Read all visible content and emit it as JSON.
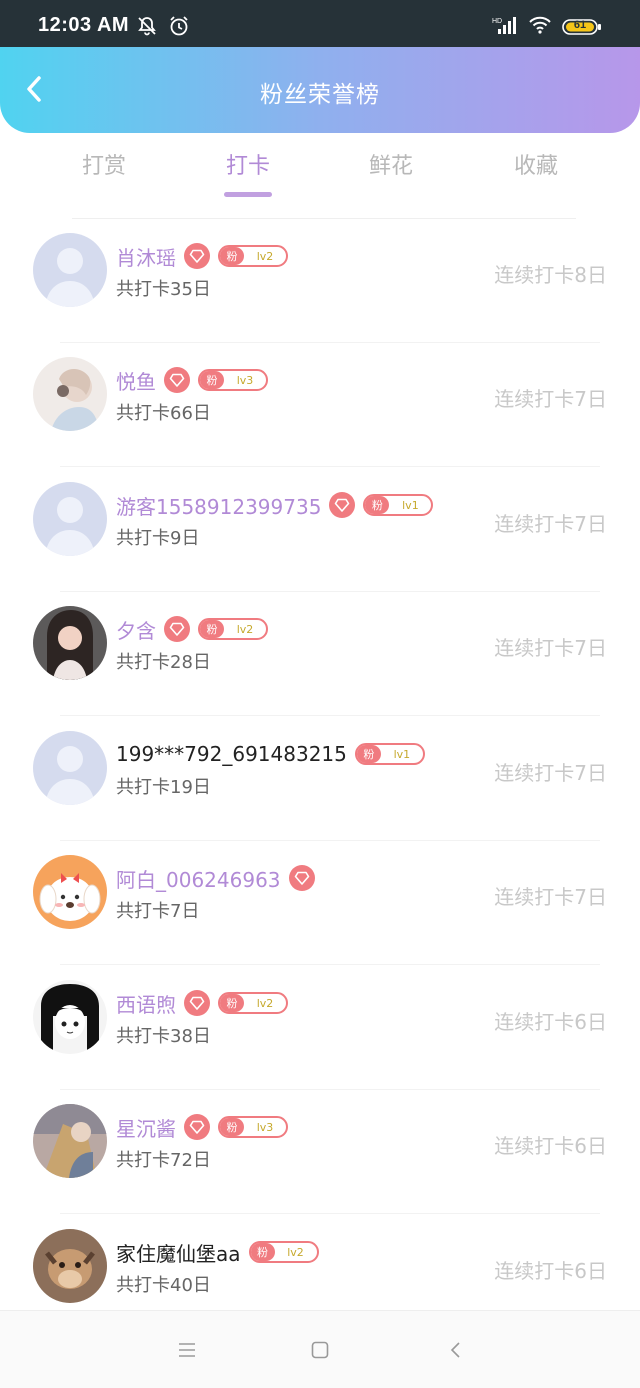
{
  "status_bar": {
    "time": "12:03 AM",
    "battery": "61"
  },
  "header": {
    "title": "粉丝荣誉榜"
  },
  "tabs": [
    {
      "label": "打赏"
    },
    {
      "label": "打卡",
      "active": true
    },
    {
      "label": "鲜花"
    },
    {
      "label": "收藏"
    }
  ],
  "rows": [
    {
      "name": "肖沐瑶",
      "name_style": "purple",
      "heart": true,
      "level": "lv2",
      "total": "共打卡35日",
      "streak": "连续打卡8日",
      "avatar": "default-avatar"
    },
    {
      "name": "悦鱼",
      "name_style": "purple",
      "heart": true,
      "level": "lv3",
      "total": "共打卡66日",
      "streak": "连续打卡7日",
      "avatar": "photo-avatar"
    },
    {
      "name": "游客1558912399735",
      "name_style": "purple",
      "heart": true,
      "level": "lv1",
      "total": "共打卡9日",
      "streak": "连续打卡7日",
      "avatar": "default-avatar"
    },
    {
      "name": "夕含",
      "name_style": "purple",
      "heart": true,
      "level": "lv2",
      "total": "共打卡28日",
      "streak": "连续打卡7日",
      "avatar": "photo-avatar"
    },
    {
      "name": "199***792_691483215",
      "name_style": "plain",
      "heart": false,
      "level": "lv1",
      "total": "共打卡19日",
      "streak": "连续打卡7日",
      "avatar": "default-avatar"
    },
    {
      "name": "阿白_006246963",
      "name_style": "purple",
      "heart": true,
      "level": "",
      "total": "共打卡7日",
      "streak": "连续打卡7日",
      "avatar": "cartoon-dog-avatar"
    },
    {
      "name": "西语煦",
      "name_style": "purple",
      "heart": true,
      "level": "lv2",
      "total": "共打卡38日",
      "streak": "连续打卡6日",
      "avatar": "anime-avatar"
    },
    {
      "name": "星沉酱",
      "name_style": "purple",
      "heart": true,
      "level": "lv3",
      "total": "共打卡72日",
      "streak": "连续打卡6日",
      "avatar": "photo-avatar"
    },
    {
      "name": "家住魔仙堡aa",
      "name_style": "plain",
      "heart": false,
      "level": "lv2",
      "total": "共打卡40日",
      "streak": "连续打卡6日",
      "avatar": "animal-avatar"
    }
  ],
  "fan_badge_label": "粉",
  "colors": {
    "accent": "#b18ad6",
    "badge": "#f07b80",
    "level_text": "#c6a92d"
  }
}
